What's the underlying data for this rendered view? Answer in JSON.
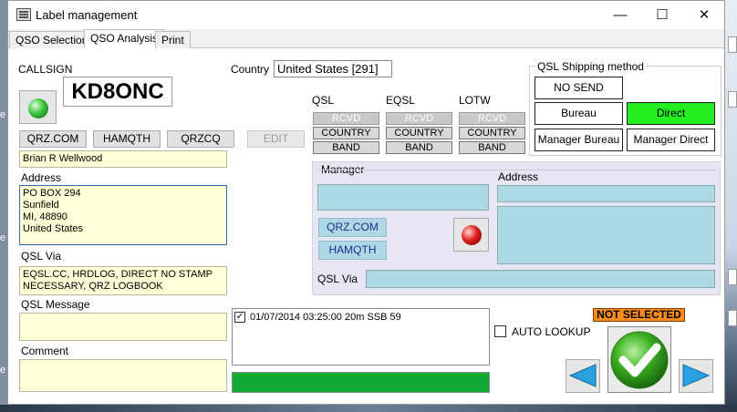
{
  "window": {
    "title": "Label management"
  },
  "tabs": [
    {
      "label": "QSO Selection"
    },
    {
      "label": "QSO Analysis"
    },
    {
      "label": "Print"
    }
  ],
  "callsign": {
    "label": "CALLSIGN",
    "value": "KD8ONC"
  },
  "country": {
    "label": "Country",
    "value": "United States [291]"
  },
  "lookup_buttons": {
    "qrz": "QRZ.COM",
    "hamqth": "HAMQTH",
    "qrzcq": "QRZCQ",
    "edit": "EDIT"
  },
  "name": {
    "value": "Brian R Wellwood"
  },
  "address": {
    "label": "Address",
    "value": "PO BOX 294\nSunfield\nMI, 48890\nUnited States"
  },
  "qsl_via": {
    "label": "QSL Via",
    "value": "EQSL.CC, HRDLOG, DIRECT NO STAMP NECESSARY, QRZ LOGBOOK"
  },
  "qsl_message": {
    "label": "QSL Message",
    "value": ""
  },
  "comment": {
    "label": "Comment",
    "value": ""
  },
  "status_columns": [
    {
      "header": "QSL",
      "rcvd": "RCVD",
      "country": "COUNTRY",
      "band": "BAND"
    },
    {
      "header": "EQSL",
      "rcvd": "RCVD",
      "country": "COUNTRY",
      "band": "BAND"
    },
    {
      "header": "LOTW",
      "rcvd": "RCVD",
      "country": "COUNTRY",
      "band": "BAND"
    }
  ],
  "shipping": {
    "legend": "QSL Shipping method",
    "no_send": "NO SEND",
    "bureau": "Bureau",
    "direct": "Direct",
    "manager_bureau": "Manager Bureau",
    "manager_direct": "Manager Direct",
    "selected_color": "#22ee22"
  },
  "manager": {
    "legend": "Manager",
    "address_label": "Address",
    "qrz": "QRZ.COM",
    "hamqth": "HAMQTH",
    "qsl_via_label": "QSL Via"
  },
  "qso_list": {
    "items": [
      {
        "text": "01/07/2014 03:25:00 20m SSB 59",
        "checked": true
      }
    ]
  },
  "progress": {
    "fraction": 1.0,
    "color": "#11aa33"
  },
  "auto_lookup": {
    "label": "AUTO LOOKUP",
    "checked": false
  },
  "status_badge": {
    "text": "NOT SELECTED",
    "color": "#ff8c1a"
  }
}
